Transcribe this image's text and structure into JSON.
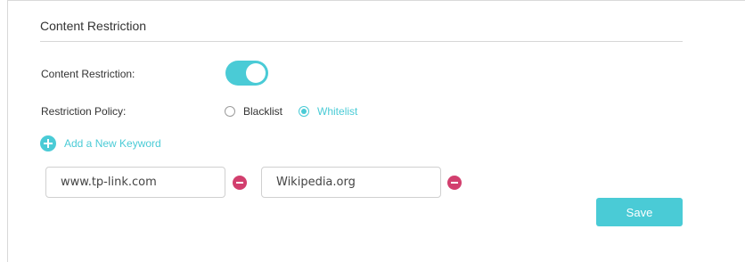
{
  "section": {
    "title": "Content Restriction"
  },
  "content_restriction": {
    "label": "Content Restriction:",
    "enabled": true
  },
  "restriction_policy": {
    "label": "Restriction Policy:",
    "options": [
      "Blacklist",
      "Whitelist"
    ],
    "selected": "Whitelist"
  },
  "add_keyword": {
    "label": "Add a New Keyword"
  },
  "keywords": [
    "www.tp-link.com",
    "Wikipedia.org"
  ],
  "save": {
    "label": "Save"
  },
  "colors": {
    "accent": "#4acbd6",
    "delete": "#d23f6e",
    "text": "#333333"
  },
  "icons": {
    "add": "plus-circle-icon",
    "remove": "minus-circle-icon"
  }
}
